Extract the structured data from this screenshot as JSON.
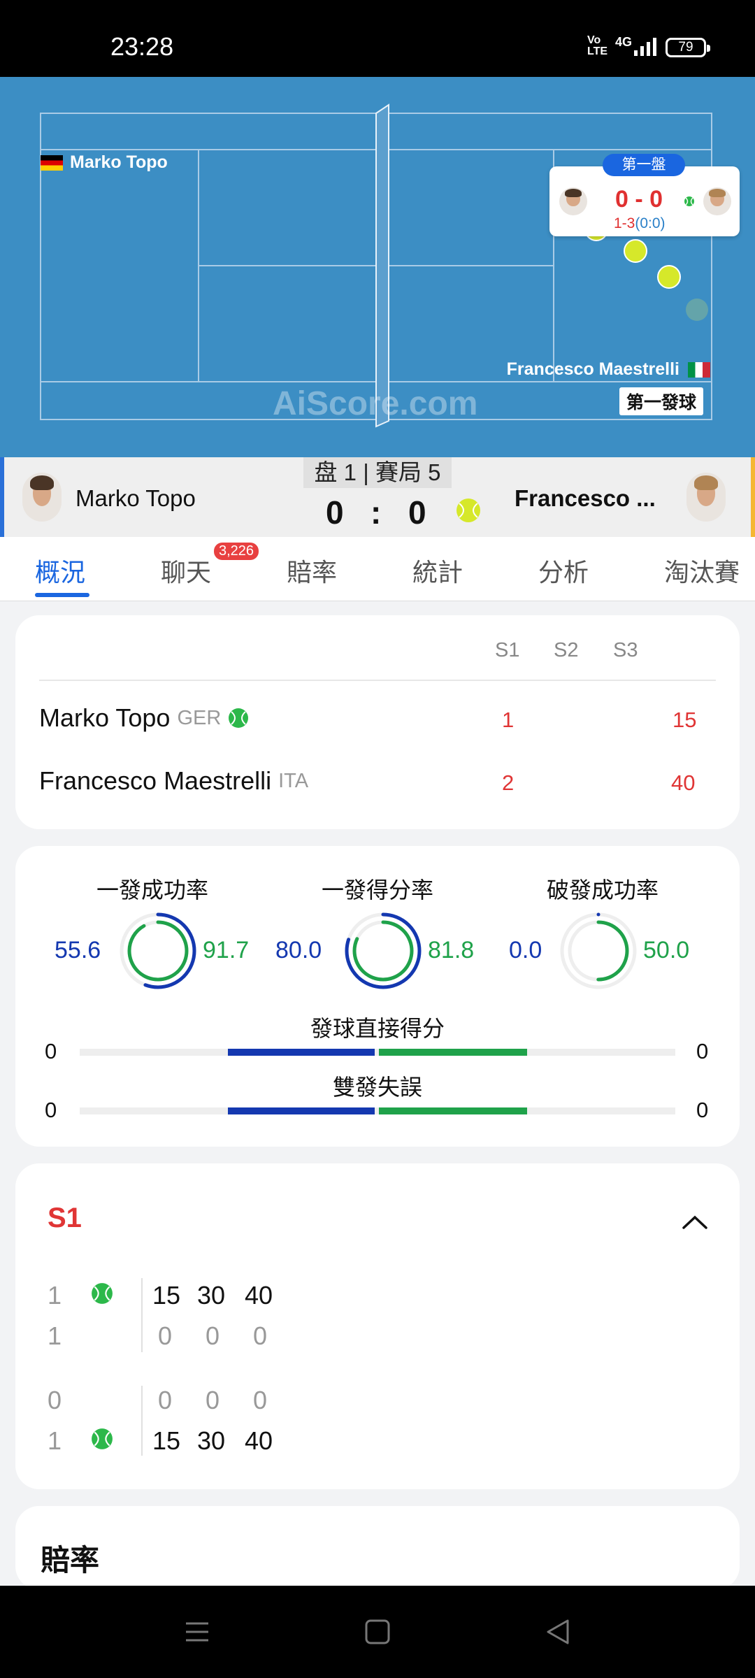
{
  "status_bar": {
    "time": "23:28",
    "volte": "Vo\nLTE",
    "network": "4G",
    "battery": "79"
  },
  "court": {
    "watermark": "AiScore.com",
    "player1_name": "Marko Topo",
    "player2_name": "Francesco Maestrelli",
    "serve_label": "第一發球",
    "mini_score": {
      "set_label": "第一盤",
      "score": "0 - 0",
      "games": "1-3",
      "games_tiebreak": "(0:0)"
    }
  },
  "scoreboard": {
    "set_info": "盘 1 | 賽局 5",
    "player1": "Marko Topo",
    "player2": "Francesco ...",
    "score_home": "0",
    "score_separator": ":",
    "score_away": "0"
  },
  "tabs": [
    {
      "label": "概況",
      "active": true
    },
    {
      "label": "聊天",
      "badge": "3,226"
    },
    {
      "label": "賠率"
    },
    {
      "label": "統計"
    },
    {
      "label": "分析"
    },
    {
      "label": "淘汰賽"
    }
  ],
  "set_table": {
    "headers": [
      "S1",
      "S2",
      "S3"
    ],
    "rows": [
      {
        "name": "Marko Topo",
        "nat": "GER",
        "serving": true,
        "s1": "1",
        "s2": "",
        "current": "15"
      },
      {
        "name": "Francesco Maestrelli",
        "nat": "ITA",
        "serving": false,
        "s1": "2",
        "s2": "",
        "current": "40"
      }
    ]
  },
  "stats": {
    "rings": [
      {
        "title": "一發成功率",
        "left": "55.6",
        "right": "91.7",
        "left_pct": 55.6,
        "right_pct": 91.7
      },
      {
        "title": "一發得分率",
        "left": "80.0",
        "right": "81.8",
        "left_pct": 80.0,
        "right_pct": 81.8
      },
      {
        "title": "破發成功率",
        "left": "0.0",
        "right": "50.0",
        "left_pct": 0.0,
        "right_pct": 50.0
      }
    ],
    "bars": [
      {
        "title": "發球直接得分",
        "left": "0",
        "right": "0"
      },
      {
        "title": "雙發失誤",
        "left": "0",
        "right": "0"
      }
    ]
  },
  "set_detail": {
    "label": "S1",
    "games": [
      {
        "top": {
          "game": "1",
          "serve": true,
          "points": [
            "15",
            "30",
            "40"
          ],
          "dark": true
        },
        "bottom": {
          "game": "1",
          "serve": false,
          "points": [
            "0",
            "0",
            "0"
          ],
          "dark": false
        }
      },
      {
        "top": {
          "game": "0",
          "serve": false,
          "points": [
            "0",
            "0",
            "0"
          ],
          "dark": false
        },
        "bottom": {
          "game": "1",
          "serve": true,
          "points": [
            "15",
            "30",
            "40"
          ],
          "dark": true
        }
      }
    ]
  },
  "odds_section": {
    "title": "賠率"
  },
  "colors": {
    "primary_blue": "#1a66e0",
    "stat_blue": "#1438b0",
    "stat_green": "#1fa24a",
    "score_red": "#e03535",
    "court": "#3c8ec4"
  }
}
